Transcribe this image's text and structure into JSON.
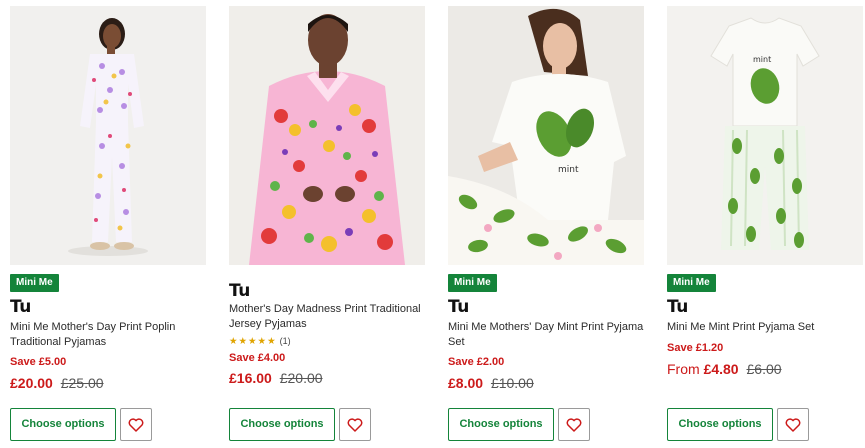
{
  "products": [
    {
      "badge": "Mini Me",
      "brand": "Tu",
      "name": "Mini Me Mother's Day Print Poplin Traditional Pyjamas",
      "save": "Save £5.00",
      "price_prefix": "",
      "price": "£20.00",
      "was_price": "£25.00",
      "cta": "Choose options",
      "image_icon": "pyjama-product-photo"
    },
    {
      "badge": "",
      "brand": "Tu",
      "name": "Mother's Day Madness Print Traditional Jersey Pyjamas",
      "rating_stars": "★★★★★",
      "rating_value": 5,
      "rating_count": "(1)",
      "save": "Save £4.00",
      "price_prefix": "",
      "price": "£16.00",
      "was_price": "£20.00",
      "cta": "Choose options",
      "image_icon": "pyjama-product-photo"
    },
    {
      "badge": "Mini Me",
      "brand": "Tu",
      "name": "Mini Me Mothers' Day Mint Print Pyjama Set",
      "save": "Save £2.00",
      "price_prefix": "",
      "price": "£8.00",
      "was_price": "£10.00",
      "cta": "Choose options",
      "image_icon": "pyjama-product-photo"
    },
    {
      "badge": "Mini Me",
      "brand": "Tu",
      "name": "Mini Me Mint Print Pyjama Set",
      "save": "Save £1.20",
      "price_prefix": "From",
      "price": "£4.80",
      "was_price": "£6.00",
      "cta": "Choose options",
      "image_icon": "pyjama-product-photo"
    }
  ],
  "colors": {
    "badge_bg": "#14843a",
    "sale_red": "#cc1a1a",
    "button_green": "#14843a",
    "star_gold": "#e0a400"
  },
  "icons": {
    "wishlist": "heart-outline-icon"
  }
}
